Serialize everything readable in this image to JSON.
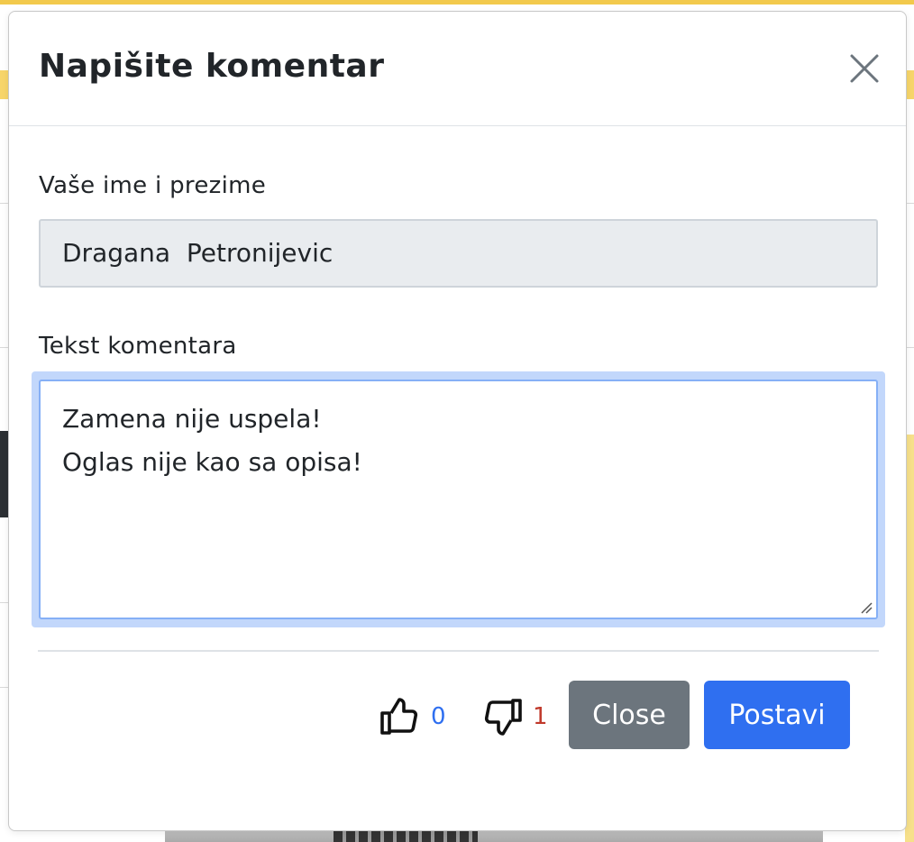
{
  "modal": {
    "title": "Napišite komentar",
    "close_icon": "close-icon",
    "name_label": "Vaše ime i prezime",
    "name_value": "Dragana  Petronijevic",
    "comment_label": "Tekst komentara",
    "comment_lines": [
      "Zamena nije uspela!",
      "Oglas nije kao sa opisa!"
    ],
    "likes": {
      "icon": "thumbs-up-icon",
      "count": "0",
      "color": "#2f6ff0"
    },
    "dislikes": {
      "icon": "thumbs-down-icon",
      "count": "1",
      "color": "#c0392b"
    },
    "close_button": "Close",
    "post_button": "Postavi"
  },
  "colors": {
    "primary": "#2f6ff0",
    "secondary": "#6c757d",
    "input_disabled_bg": "#e9ecef",
    "focus_ring": "#c2d7fb"
  }
}
